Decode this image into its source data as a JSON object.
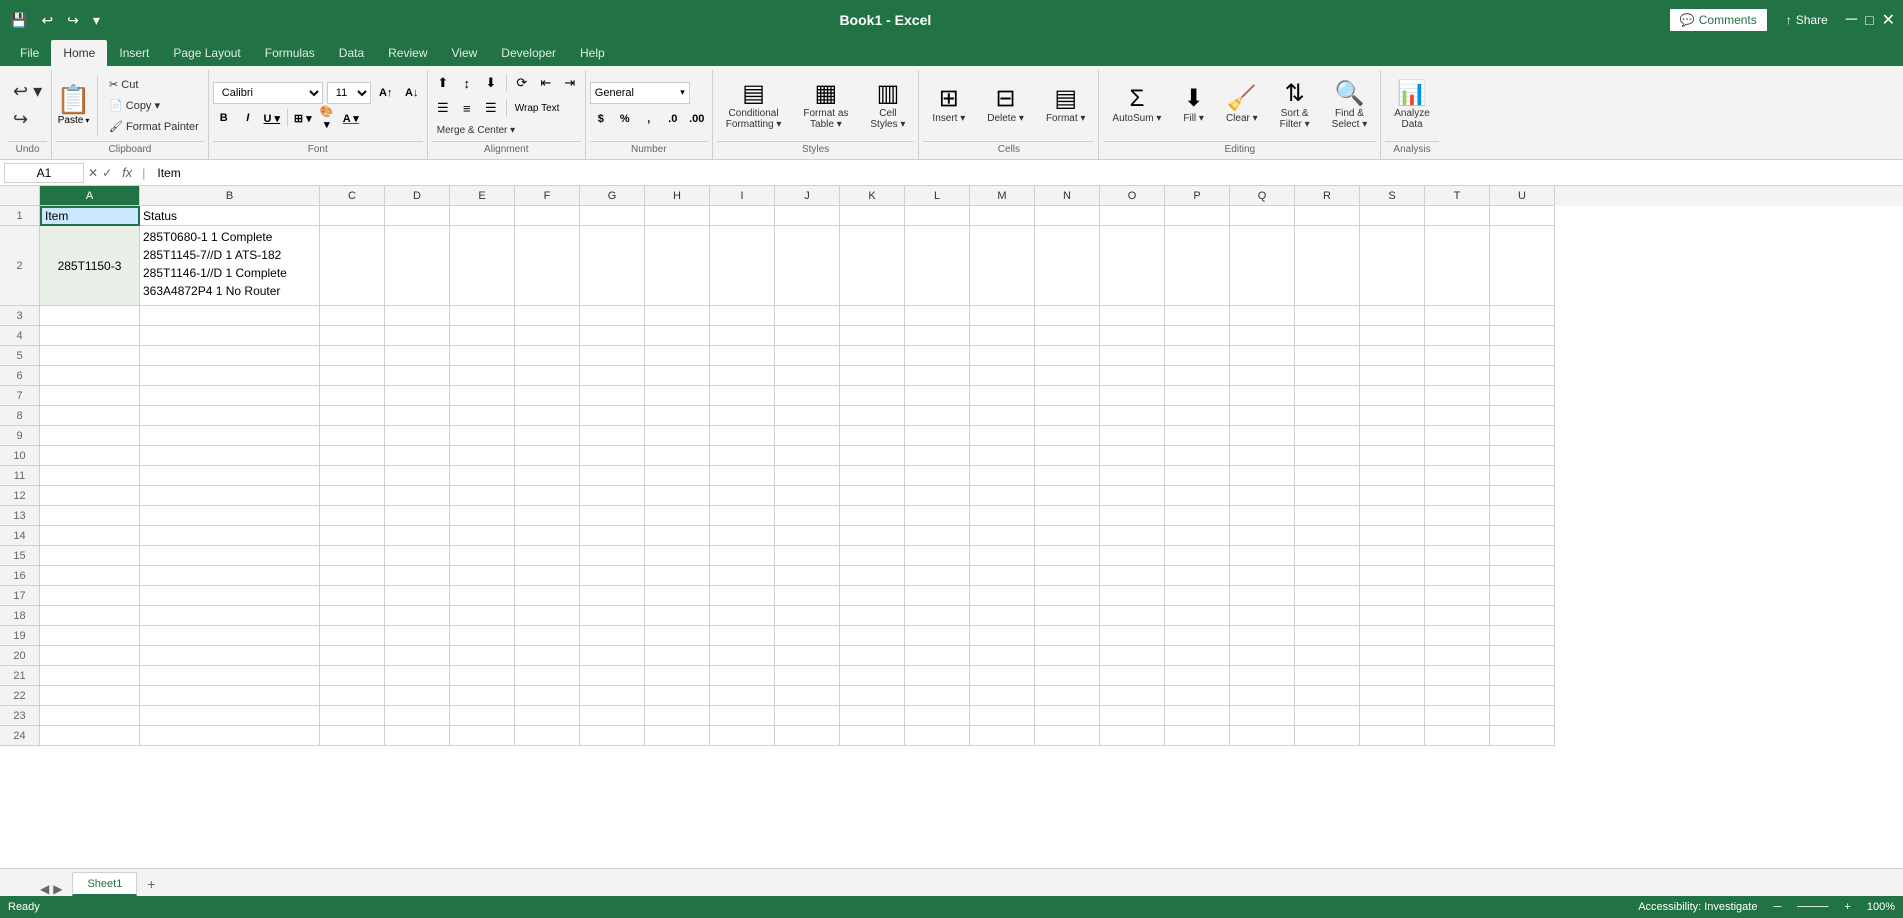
{
  "app": {
    "title": "Book1 - Excel",
    "filename": "Book1 - Excel"
  },
  "titlebar": {
    "comments_label": "Comments",
    "share_label": "Share"
  },
  "menu": {
    "items": [
      "File",
      "Home",
      "Insert",
      "Page Layout",
      "Formulas",
      "Data",
      "Review",
      "View",
      "Developer",
      "Help"
    ]
  },
  "active_menu": "Home",
  "quick_access": {
    "save_tooltip": "Save",
    "undo_tooltip": "Undo",
    "redo_tooltip": "Redo"
  },
  "ribbon": {
    "groups": [
      {
        "name": "Undo",
        "label": "Undo",
        "items": []
      },
      {
        "name": "Clipboard",
        "label": "Clipboard",
        "paste_label": "Paste"
      },
      {
        "name": "Font",
        "label": "Font",
        "font_name": "Calibri",
        "font_size": "11",
        "bold": "B",
        "italic": "I",
        "underline": "U",
        "increase_size": "A↑",
        "decrease_size": "A↓",
        "borders": "⊞",
        "fill_color": "A",
        "font_color": "A"
      },
      {
        "name": "Alignment",
        "label": "Alignment",
        "wrap_text": "Wrap Text",
        "merge_center": "Merge & Center"
      },
      {
        "name": "Number",
        "label": "Number",
        "format": "General"
      },
      {
        "name": "Styles",
        "label": "Styles",
        "conditional_formatting": "Conditional Formatting",
        "format_as_table": "Format as Table",
        "cell_styles": "Cell Styles"
      },
      {
        "name": "Cells",
        "label": "Cells",
        "insert": "Insert",
        "delete": "Delete",
        "format": "Format"
      },
      {
        "name": "Editing",
        "label": "Editing",
        "autosum": "AutoSum",
        "fill": "Fill",
        "clear": "Clear",
        "sort_filter": "Sort & Filter",
        "find_select": "Find & Select"
      },
      {
        "name": "Analysis",
        "label": "Analysis",
        "analyze_data": "Analyze Data"
      }
    ]
  },
  "formula_bar": {
    "cell_ref": "A1",
    "formula": "Item",
    "fx_label": "fx"
  },
  "columns": [
    "A",
    "B",
    "C",
    "D",
    "E",
    "F",
    "G",
    "H",
    "I",
    "J",
    "K",
    "L",
    "M",
    "N",
    "O",
    "P",
    "Q",
    "R",
    "S",
    "T",
    "U"
  ],
  "rows": [
    {
      "num": 1,
      "cells": {
        "A": "Item",
        "B": "Status"
      }
    },
    {
      "num": 2,
      "cells": {
        "A": "285T1150-3",
        "B": "285T0680-1 1 Complete\n285T1145-7//D 1 ATS-182\n285T1146-1//D 1 Complete\n363A4872P4 1 No Router"
      }
    },
    {
      "num": 3,
      "cells": {}
    },
    {
      "num": 4,
      "cells": {}
    },
    {
      "num": 5,
      "cells": {}
    },
    {
      "num": 6,
      "cells": {}
    },
    {
      "num": 7,
      "cells": {}
    },
    {
      "num": 8,
      "cells": {}
    },
    {
      "num": 9,
      "cells": {}
    },
    {
      "num": 10,
      "cells": {}
    },
    {
      "num": 11,
      "cells": {}
    },
    {
      "num": 12,
      "cells": {}
    },
    {
      "num": 13,
      "cells": {}
    },
    {
      "num": 14,
      "cells": {}
    },
    {
      "num": 15,
      "cells": {}
    },
    {
      "num": 16,
      "cells": {}
    },
    {
      "num": 17,
      "cells": {}
    },
    {
      "num": 18,
      "cells": {}
    },
    {
      "num": 19,
      "cells": {}
    },
    {
      "num": 20,
      "cells": {}
    },
    {
      "num": 21,
      "cells": {}
    },
    {
      "num": 22,
      "cells": {}
    },
    {
      "num": 23,
      "cells": {}
    },
    {
      "num": 24,
      "cells": {}
    }
  ],
  "b2_lines": [
    "285T0680-1 1 Complete",
    "285T1145-7//D 1 ATS-182",
    "285T1146-1//D 1 Complete",
    "363A4872P4 1 No Router"
  ],
  "sheet_tabs": {
    "tabs": [
      "Sheet1"
    ],
    "active": "Sheet1"
  },
  "status_bar": {
    "ready": "Ready",
    "accessibility": "Accessibility: Investigate"
  }
}
